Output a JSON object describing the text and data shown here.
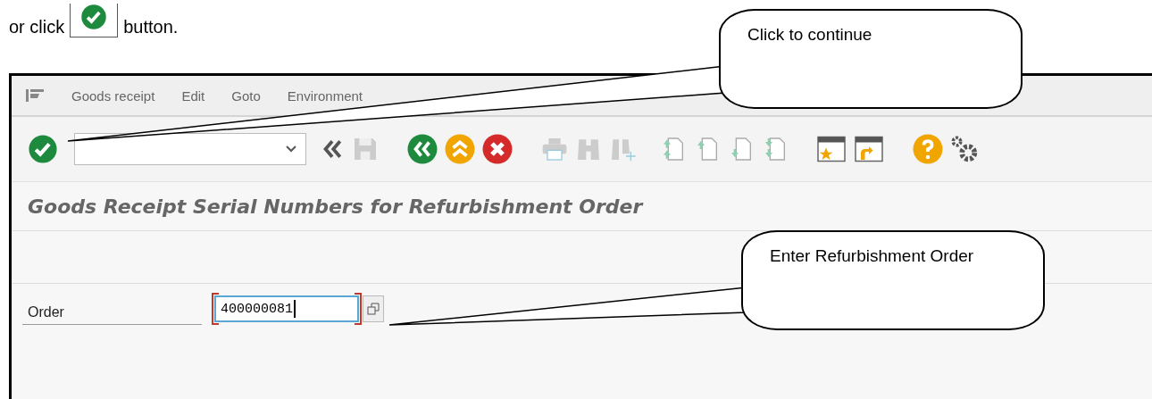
{
  "intro": {
    "before": "or click",
    "after": "button."
  },
  "window": {
    "menu": [
      "Goods receipt",
      "Edit",
      "Goto",
      "Environment"
    ],
    "title": "Goods Receipt Serial Numbers for Refurbishment Order",
    "fields": [
      {
        "label": "Order",
        "value": "400000081",
        "focused": true
      }
    ]
  },
  "callouts": [
    {
      "text": "Click to continue"
    },
    {
      "text": "Enter Refurbishment Order"
    }
  ]
}
